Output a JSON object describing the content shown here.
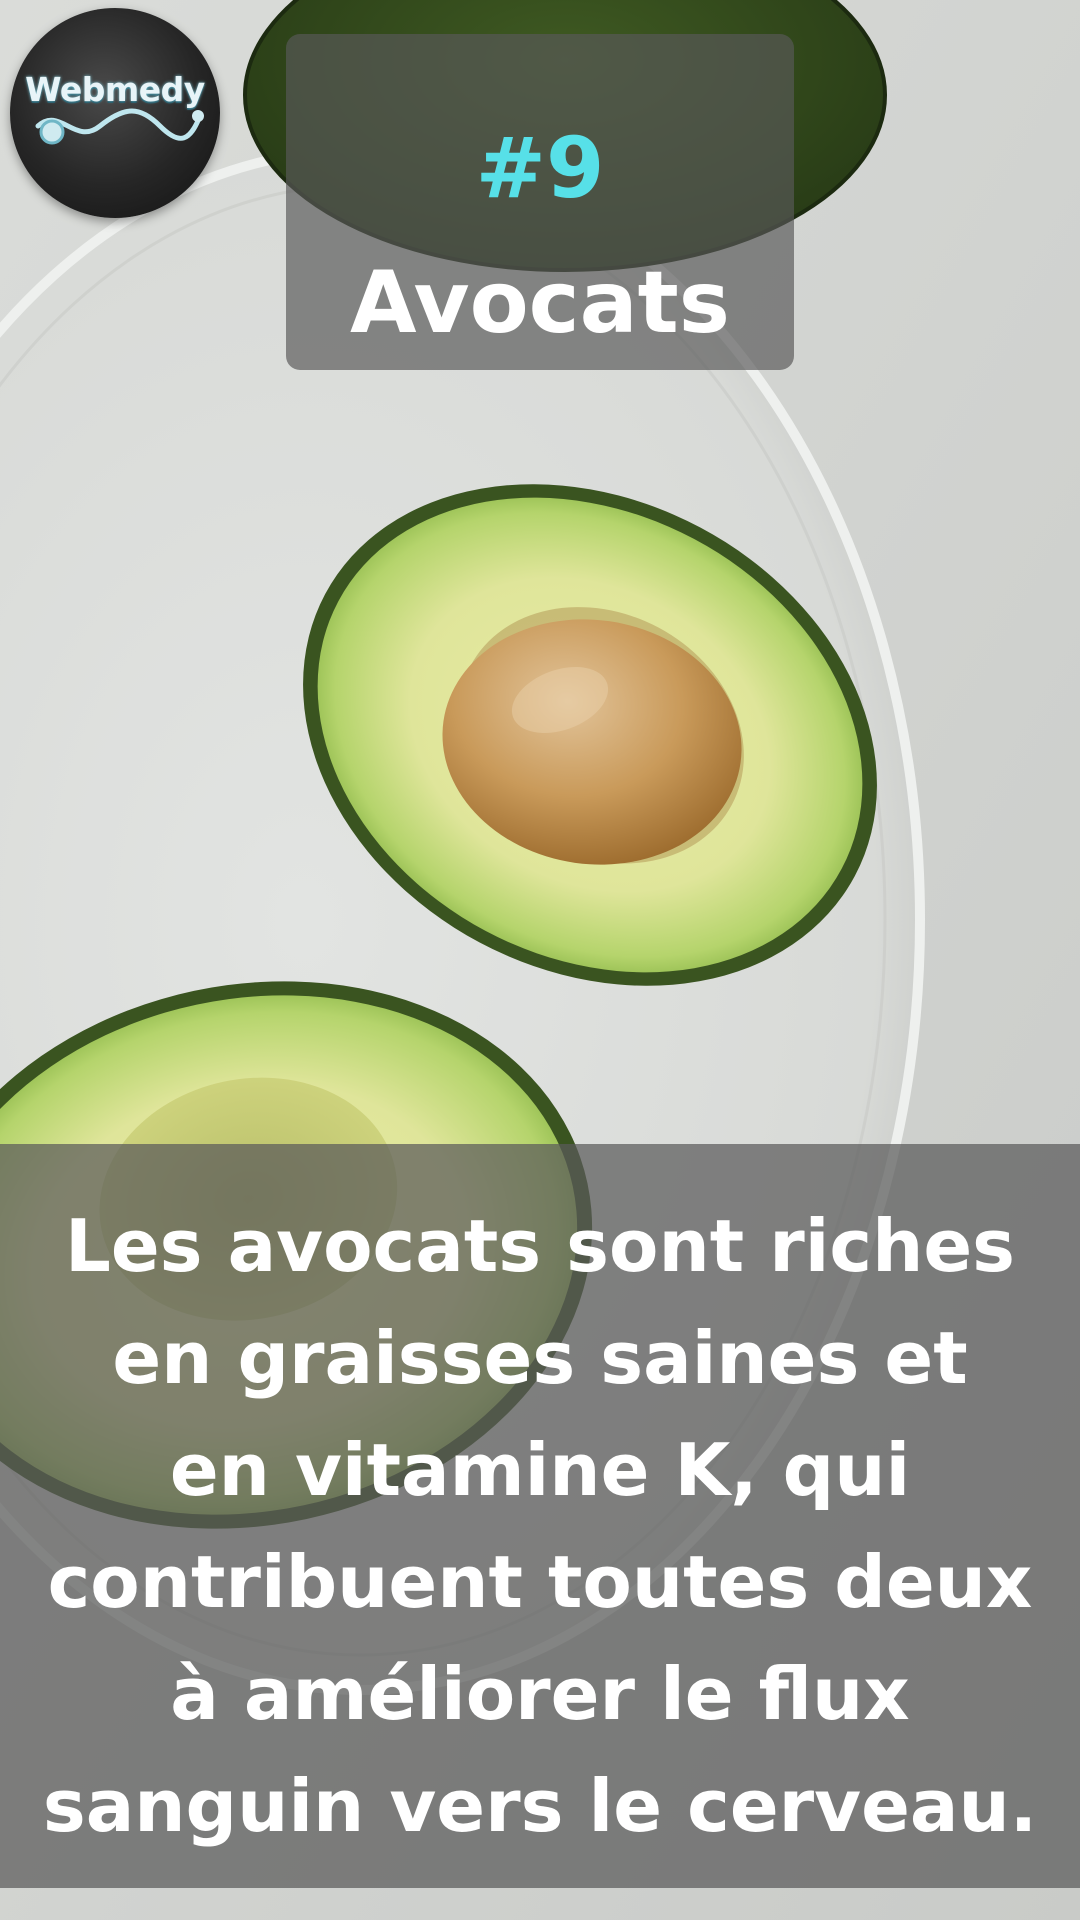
{
  "logo": {
    "text": "Webmedy"
  },
  "header": {
    "number": "#9",
    "title": "Avocats"
  },
  "caption": {
    "text": "Les avocats sont riches\nen graisses saines et\nen vitamine K, qui\ncontribuent toutes deux\nà améliorer le flux\nsanguin vers le cerveau."
  },
  "colors": {
    "number_accent": "#57e0e8",
    "text": "#ffffff",
    "panel": "#5a5a5a"
  }
}
